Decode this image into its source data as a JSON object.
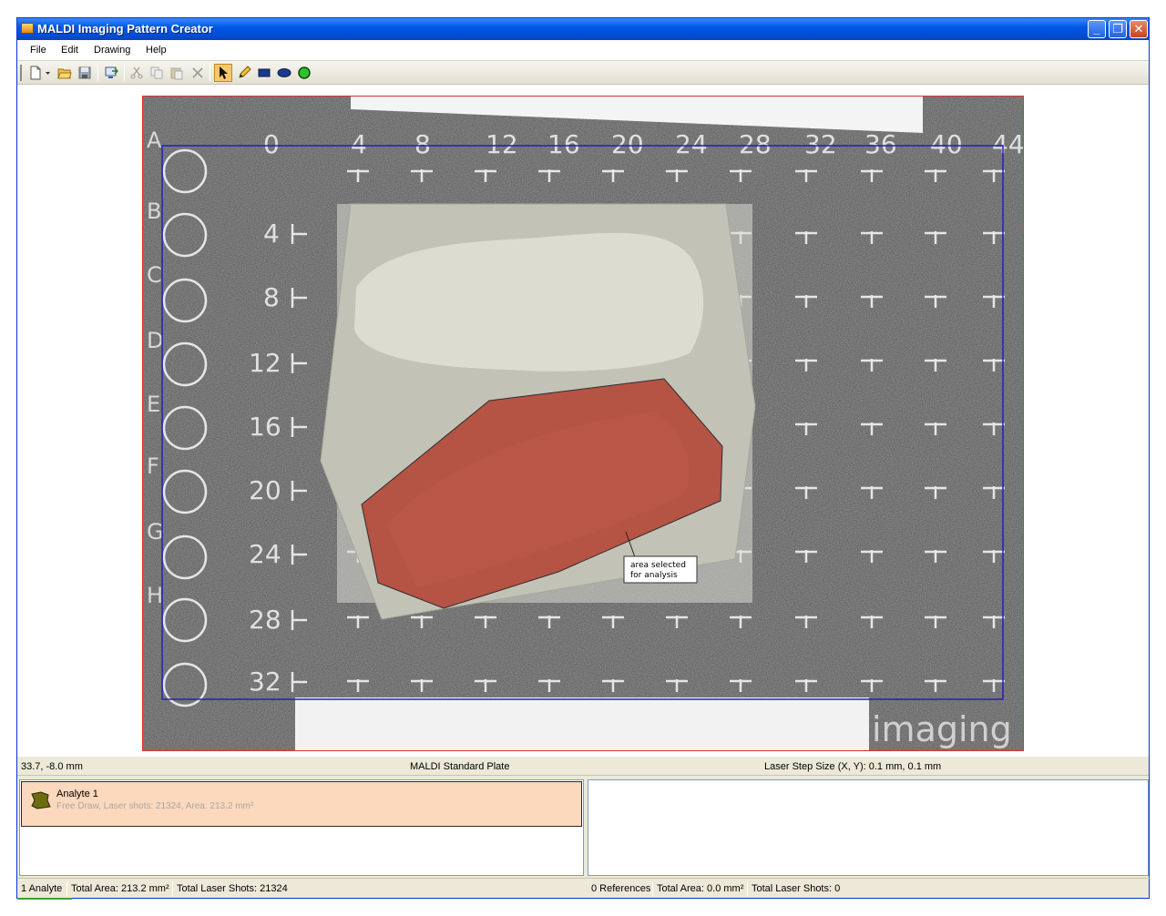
{
  "window": {
    "title": "MALDI Imaging Pattern Creator",
    "minimize": "_",
    "restore": "❐",
    "close": "✕"
  },
  "menu": {
    "file": "File",
    "edit": "Edit",
    "drawing": "Drawing",
    "help": "Help"
  },
  "toolbar": {
    "tools": [
      "new-icon",
      "open-icon",
      "save-icon",
      "export-icon",
      "cut-icon",
      "copy-icon",
      "paste-icon",
      "delete-icon",
      "pointer-icon",
      "pencil-icon",
      "rectangle-icon",
      "ellipse-icon",
      "circle-icon"
    ],
    "active_tool": "pointer-icon"
  },
  "plate": {
    "row_letters": [
      "A",
      "B",
      "C",
      "D",
      "E",
      "F",
      "G",
      "H"
    ],
    "top_numbers": [
      "0",
      "4",
      "8",
      "12",
      "16",
      "20",
      "24",
      "28",
      "32",
      "36",
      "40",
      "44"
    ],
    "side_numbers": [
      "4",
      "8",
      "12",
      "16",
      "20",
      "24",
      "28",
      "32"
    ],
    "watermark": "imaging",
    "annotation_line1": "area selected",
    "annotation_line2": "for analysis",
    "region_color": "#b44a3c",
    "border_color": "#e03030",
    "grid_color": "#2020c0"
  },
  "status_top": {
    "coords": "33.7, -8.0 mm",
    "plate": "MALDI Standard Plate",
    "step": "Laser Step Size (X, Y): 0.1 mm, 0.1 mm"
  },
  "analyte": {
    "name": "Analyte 1",
    "detail": "Free Draw, Laser shots: 21324, Area: 213.2 mm²",
    "color": "#6b6b10"
  },
  "status_bottom_left": {
    "count": "1 Analyte",
    "area": "Total Area: 213.2 mm²",
    "shots": "Total Laser Shots: 21324"
  },
  "status_bottom_right": {
    "count": "0 References",
    "area": "Total Area: 0.0 mm²",
    "shots": "Total Laser Shots: 0"
  }
}
